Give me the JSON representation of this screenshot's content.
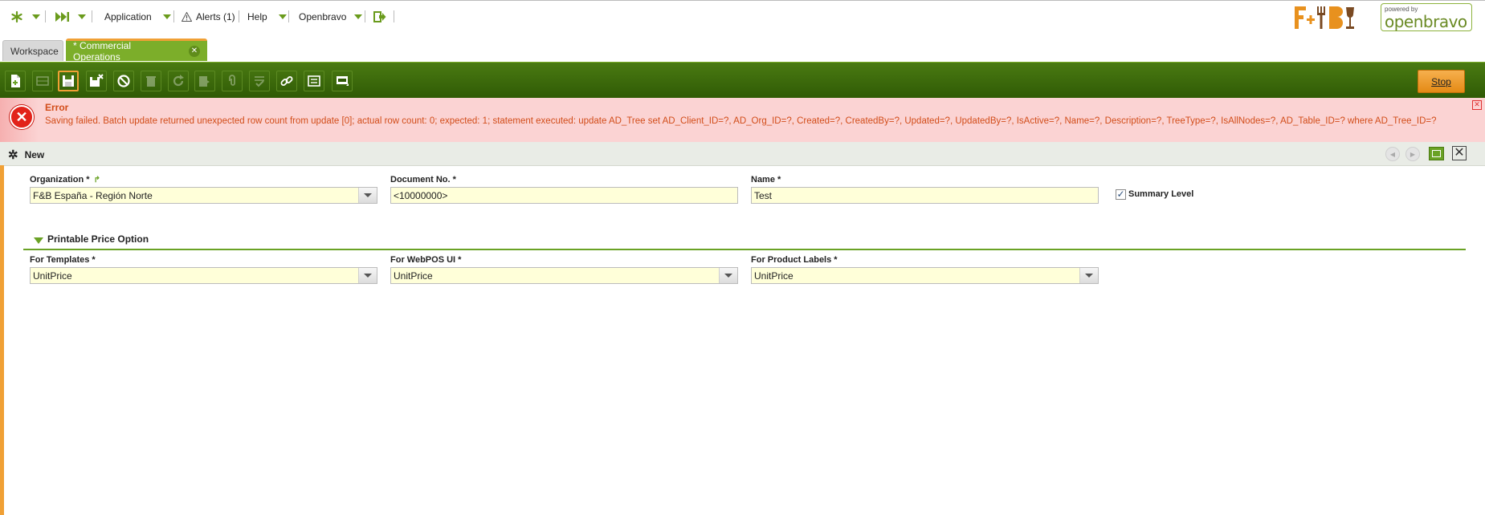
{
  "nav": {
    "application": "Application",
    "alerts": "Alerts (1)",
    "help": "Help",
    "openbravo": "Openbravo"
  },
  "branding": {
    "company_logo": "F&B",
    "powered_by": "powered by",
    "product_logo": "openbravo"
  },
  "tabs": [
    {
      "label": "Workspace"
    },
    {
      "label": "* Commercial Operations"
    }
  ],
  "toolbar": {
    "stop_label": "Stop",
    "buttons": [
      "new-document-icon",
      "new-row-icon",
      "save-icon",
      "save-close-icon",
      "undo-icon",
      "delete-icon",
      "refresh-icon",
      "export-icon",
      "attach-icon",
      "audit-icon",
      "link-icon",
      "print-icon",
      "grid-form-icon"
    ]
  },
  "error": {
    "title": "Error",
    "message": "Saving failed. Batch update returned unexpected row count from update [0]; actual row count: 0; expected: 1; statement executed: update AD_Tree set AD_Client_ID=?, AD_Org_ID=?, Created=?, CreatedBy=?, Updated=?, UpdatedBy=?, IsActive=?, Name=?, Description=?, TreeType=?, IsAllNodes=?, AD_Table_ID=? where AD_Tree_ID=?"
  },
  "status": {
    "mode": "New"
  },
  "form": {
    "organization": {
      "label": "Organization *",
      "value": "F&B España - Región Norte"
    },
    "document_no": {
      "label": "Document No. *",
      "value": "<10000000>"
    },
    "name": {
      "label": "Name *",
      "value": "Test"
    },
    "summary_level": {
      "label": "Summary Level",
      "checked": true
    }
  },
  "section": {
    "title": "Printable Price Option",
    "for_templates": {
      "label": "For Templates *",
      "value": "UnitPrice"
    },
    "for_webpos": {
      "label": "For WebPOS UI *",
      "value": "UnitPrice"
    },
    "for_product_labels": {
      "label": "For Product Labels *",
      "value": "UnitPrice"
    }
  },
  "colors": {
    "accent_green": "#6aa225",
    "accent_orange": "#f0a035",
    "error_bg": "#fbd3d3",
    "error_text": "#d24d1a",
    "field_bg": "#ffffd9"
  }
}
